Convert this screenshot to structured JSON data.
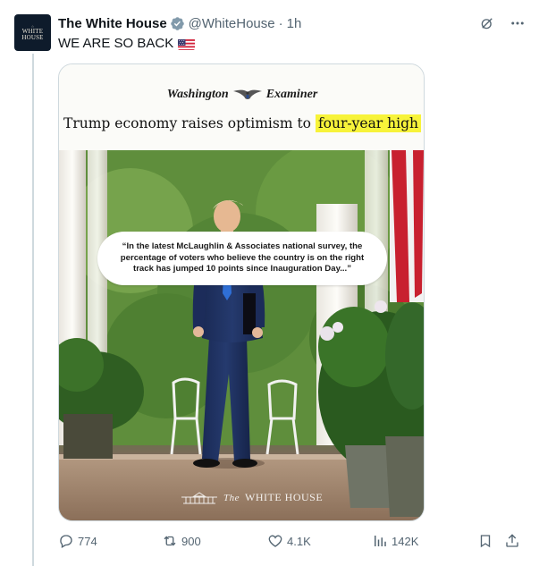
{
  "post": {
    "author_name": "The White House",
    "handle": "@WhiteHouse",
    "separator": "·",
    "time": "1h",
    "text": "WE ARE SO BACK",
    "avatar_text": "WHITE HOUSE"
  },
  "media": {
    "masthead_left": "Washington",
    "masthead_right": "Examiner",
    "headline_prefix": "Trump economy raises optimism to ",
    "headline_highlight": "four-year high",
    "quote": "“In the latest McLaughlin & Associates national survey, the percentage of voters who believe the country is on the right track has jumped 10 points since Inauguration Day...”",
    "watermark_the": "The",
    "watermark_name": "WHITE HOUSE"
  },
  "actions": {
    "replies": "774",
    "reposts": "900",
    "likes": "4.1K",
    "views": "142K"
  },
  "icons": [
    "verified-badge-icon",
    "grok-icon",
    "more-icon",
    "us-flag-emoji",
    "reply-icon",
    "repost-icon",
    "like-icon",
    "views-icon",
    "bookmark-icon",
    "share-icon"
  ],
  "colors": {
    "highlight": "#f7f33a",
    "verified": "#829aab",
    "muted": "#536471",
    "avatar_bg": "#0e1b2b"
  }
}
